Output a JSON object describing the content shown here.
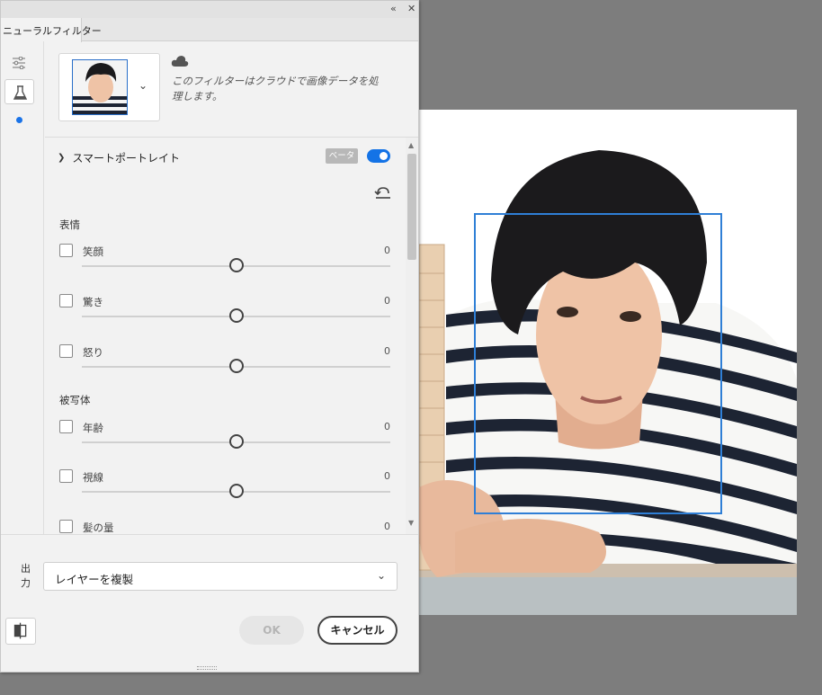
{
  "panel": {
    "title_icons": {
      "collapse": "double-chevron-left-icon",
      "close": "close-icon"
    },
    "tab_label": "ニューラルフィルター"
  },
  "rail": {
    "icons": [
      "sliders-icon",
      "flask-icon"
    ],
    "active_dot_color": "#1a73e8"
  },
  "cloud": {
    "icon": "cloud-icon",
    "text": "このフィルターはクラウドで画像データを処理します。"
  },
  "section": {
    "title": "スマートポートレイト",
    "badge": "ベータ",
    "toggle_on": true,
    "accent": "#1473e6"
  },
  "groups": [
    {
      "label": "表情",
      "items": [
        {
          "label": "笑顔",
          "value": "0",
          "level": 0.5
        },
        {
          "label": "驚き",
          "value": "0",
          "level": 0.5
        },
        {
          "label": "怒り",
          "value": "0",
          "level": 0.5
        }
      ]
    },
    {
      "label": "被写体",
      "items": [
        {
          "label": "年齢",
          "value": "0",
          "level": 0.5
        },
        {
          "label": "視線",
          "value": "0",
          "level": 0.5
        },
        {
          "label": "髪の量",
          "value": "0",
          "level": 0.5
        }
      ]
    }
  ],
  "output": {
    "label": "出力",
    "selected": "レイヤーを複製"
  },
  "buttons": {
    "ok": "OK",
    "cancel": "キャンセル"
  },
  "canvas": {
    "face_box_color": "#2f7fd6"
  }
}
